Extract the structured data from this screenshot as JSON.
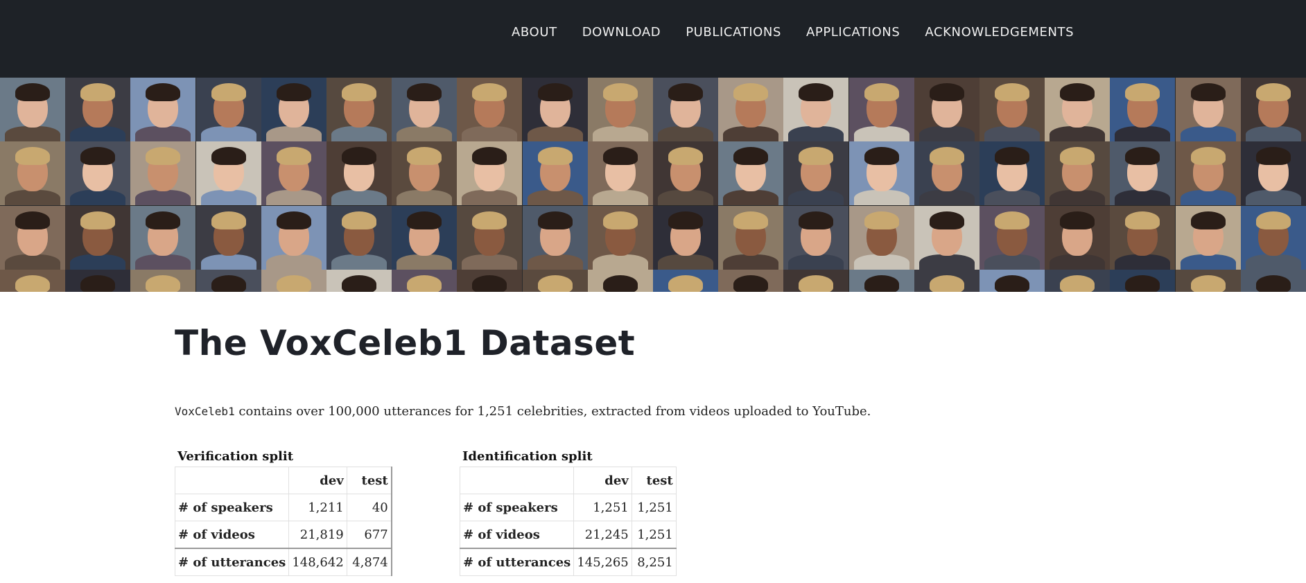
{
  "nav": {
    "items": [
      "ABOUT",
      "DOWNLOAD",
      "PUBLICATIONS",
      "APPLICATIONS",
      "ACKNOWLEDGEMENTS"
    ]
  },
  "banner": {
    "description_icon": "celebrity-face-collage"
  },
  "page": {
    "title": "The VoxCeleb1 Dataset",
    "intro_code": "VoxCeleb1",
    "intro_text": " contains over 100,000 utterances for 1,251 celebrities, extracted from videos uploaded to YouTube."
  },
  "verification": {
    "caption": "Verification split",
    "columns": [
      "",
      "dev",
      "test"
    ],
    "rows": [
      {
        "label": "# of speakers",
        "dev": "1,211",
        "test": "40"
      },
      {
        "label": "# of videos",
        "dev": "21,819",
        "test": "677"
      },
      {
        "label": "# of utterances",
        "dev": "148,642",
        "test": "4,874"
      }
    ]
  },
  "identification": {
    "caption": "Identification split",
    "columns": [
      "",
      "dev",
      "test"
    ],
    "rows": [
      {
        "label": "# of speakers",
        "dev": "1,251",
        "test": "1,251"
      },
      {
        "label": "# of videos",
        "dev": "21,245",
        "test": "1,251"
      },
      {
        "label": "# of utterances",
        "dev": "145,265",
        "test": "8,251"
      }
    ]
  }
}
